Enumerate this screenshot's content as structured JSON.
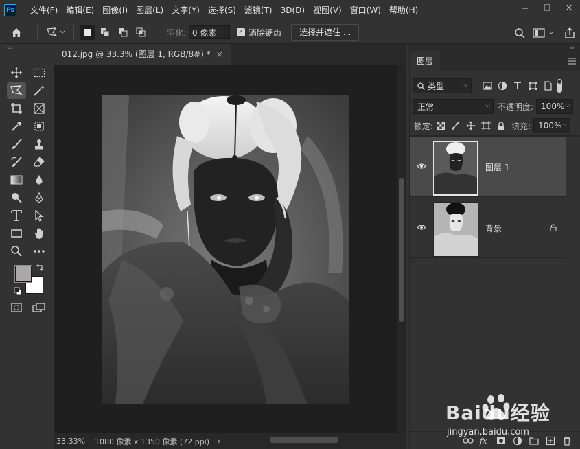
{
  "app": {
    "logo": "Ps"
  },
  "menu": [
    "文件(F)",
    "编辑(E)",
    "图像(I)",
    "图层(L)",
    "文字(Y)",
    "选择(S)",
    "滤镜(T)",
    "3D(D)",
    "视图(V)",
    "窗口(W)",
    "帮助(H)"
  ],
  "options": {
    "feather_label": "羽化:",
    "feather_value": "0 像素",
    "antialias_label": "消除锯齿",
    "select_mask_label": "选择并遮住 ..."
  },
  "document": {
    "tab_title": "012.jpg @ 33.3% (图层 1, RGB/8#) *",
    "tab_close": "×",
    "zoom": "33.33%",
    "doc_info": "1080 像素 x 1350 像素 (72 ppi)",
    "status_arrow": "›"
  },
  "layers_panel": {
    "tab_label": "图层",
    "filter_kind": "类型",
    "blend_mode": "正常",
    "opacity_label": "不透明度:",
    "opacity_value": "100%",
    "lock_label": "锁定:",
    "fill_label": "填充:",
    "fill_value": "100%",
    "layers": [
      {
        "name": "图层 1",
        "visible": true,
        "selected": true,
        "locked": false
      },
      {
        "name": "背景",
        "visible": true,
        "selected": false,
        "locked": true
      }
    ]
  },
  "watermark": {
    "text": "Baidu经验",
    "url_text": "jingyan.baidu.com"
  },
  "colors": {
    "foreground": "#aca7ab",
    "background": "#ffffff",
    "accent": "#31a8ff"
  }
}
